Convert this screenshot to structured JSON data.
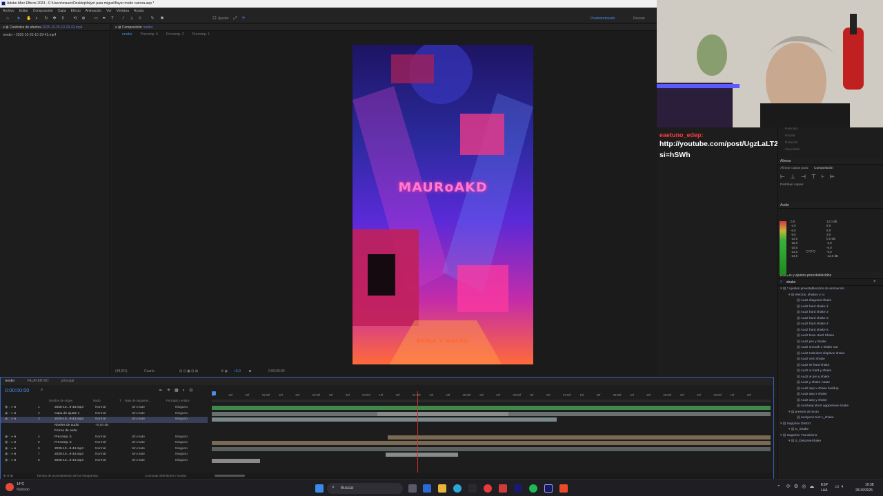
{
  "window": {
    "title": "Adobe After Effects 2024 - C:\\Users\\mauro\\Desktop\\falyer para miguel\\flayer modo carrera.aep *"
  },
  "menu": [
    "Archivo",
    "Editar",
    "Composición",
    "Capa",
    "Efecto",
    "Animación",
    "Ver",
    "Ventana",
    "Ayuda"
  ],
  "toolbar": {
    "snap_label": "Ajustar",
    "workspace_active": "Predeterminado",
    "workspace_other": "Revisar"
  },
  "effects_panel": {
    "title": "Controles de efectos",
    "layer": "2025-10-25-10-29-43.mp4",
    "row": "render • 2025-10-25-10-29-43.mp4"
  },
  "composition_panel": {
    "title": "Composición",
    "comp_name": "render",
    "tabs": [
      "render",
      "Precomp. 5",
      "Precomp. 2",
      "Precomp. 1"
    ],
    "zoom": "(48,5%)",
    "resolution": "Cuarto",
    "exposure": "+0,0",
    "timecode": "0:00:00:00"
  },
  "canvas": {
    "title_text": "MAURoAKD",
    "subtitle_text": "BENJA X NACHO"
  },
  "chat": {
    "username": "eaetuno_edep:",
    "message": "http://youtube.com/post/UgzLaLT28Q8koXw_Xe14AaABCQ?si=hSWh"
  },
  "right_panel": {
    "peek": [
      "Posición",
      "Escala",
      "Rotación",
      "Opacidad"
    ],
    "align_title": "Alinear",
    "align_to_label": "Alinear capas para:",
    "align_to_value": "Composición",
    "distribute_label": "Distribuir capas:",
    "audio_title": "Audio",
    "audio_left_scale": [
      "0,0",
      "-3,0",
      "-6,0",
      "-9,0",
      "-12,0",
      "-15,0",
      "-18,0",
      "-21,0",
      "-24,0"
    ],
    "audio_right_scale": [
      "12,0 dB",
      "9,0",
      "6,0",
      "3,0",
      "0,0 dB",
      "-3,0",
      "-6,0",
      "-9,0",
      "-12,0 dB"
    ],
    "effects_title": "Efectos y ajustes preestablecidos",
    "search_value": "shake",
    "tree": [
      {
        "label": "* Ajustes preestablecidos de animación",
        "depth": 0
      },
      {
        "label": "efectos, shakes y cc",
        "depth": 1
      },
      {
        "label": "Audz diagonal shake",
        "depth": 2
      },
      {
        "label": "Audz hard shake 1",
        "depth": 2
      },
      {
        "label": "Audz hard shake 2",
        "depth": 2
      },
      {
        "label": "Audz hard shake 3",
        "depth": 2
      },
      {
        "label": "Audz hard shake 4",
        "depth": 2
      },
      {
        "label": "Audz hard shake 5",
        "depth": 2
      },
      {
        "label": "Audz New Hard Shake",
        "depth": 2
      },
      {
        "label": "Audz pre y shake",
        "depth": 2
      },
      {
        "label": "Audz smooth x shake out",
        "depth": 2
      },
      {
        "label": "Audz turbulent displace shake",
        "depth": 2
      },
      {
        "label": "Audz velo shake",
        "depth": 2
      },
      {
        "label": "Audz W hard shake",
        "depth": 2
      },
      {
        "label": "Audz w hard y shake",
        "depth": 2
      },
      {
        "label": "Audz w pre y shake",
        "depth": 2
      },
      {
        "label": "Audz y shake rotate",
        "depth": 2
      },
      {
        "label": "Audz aep x shake buildup",
        "depth": 2
      },
      {
        "label": "Audz aep x shake",
        "depth": 2
      },
      {
        "label": "Audz aep y shake",
        "depth": 2
      },
      {
        "label": "Audzaep short aggressive shake",
        "depth": 2
      },
      {
        "label": "presets de texto",
        "depth": 1
      },
      {
        "label": "onelyene text c_shake",
        "depth": 2
      },
      {
        "label": "Sapphire Distort",
        "depth": 0
      },
      {
        "label": "S_Shake",
        "depth": 1
      },
      {
        "label": "Sapphire Transitions",
        "depth": 0
      },
      {
        "label": "S_DissolveShake",
        "depth": 1
      }
    ]
  },
  "timeline": {
    "tabs": [
      "render",
      "FALAYER MC",
      "principal"
    ],
    "timecode": "0:00:00:00",
    "columns": [
      "Nombre de origen",
      "Modo",
      "T",
      "Mate de seguimie...",
      "Principal y enlace"
    ],
    "ruler": [
      "0f",
      "10f",
      "20f",
      "01:00f",
      "10f",
      "20f",
      "02:00f",
      "10f",
      "20f",
      "03:00f",
      "10f",
      "20f",
      "04:00f",
      "10f",
      "20f",
      "05:00f",
      "10f",
      "20f",
      "06:00f",
      "10f",
      "20f",
      "07:00f",
      "10f",
      "20f",
      "08:00f",
      "10f",
      "20f",
      "09:00f",
      "10f",
      "20f",
      "10:00f",
      "10f",
      "20f"
    ],
    "layers": [
      {
        "num": "1",
        "name": "2025-10...9-43.mp4",
        "mode": "Normal",
        "matte": "Sin mate",
        "parent": "Ninguno"
      },
      {
        "num": "2",
        "name": "Capa de ajuste 1",
        "mode": "Normal",
        "matte": "Sin mate",
        "parent": "Ninguno"
      },
      {
        "num": "3",
        "name": "2025-10...9-43.mp4",
        "mode": "Normal",
        "matte": "Sin mate",
        "parent": "Ninguno"
      },
      {
        "num": "",
        "name": "Niveles de audio",
        "mode": "+0,00 dB",
        "matte": "",
        "parent": ""
      },
      {
        "num": "",
        "name": "Forma de onda",
        "mode": "",
        "matte": "",
        "parent": ""
      },
      {
        "num": "4",
        "name": "Precomp. 6",
        "mode": "Normal",
        "matte": "Sin mate",
        "parent": "Ninguno"
      },
      {
        "num": "5",
        "name": "Precomp. 5",
        "mode": "Normal",
        "matte": "Sin mate",
        "parent": "Ninguno"
      },
      {
        "num": "6",
        "name": "2025-10...6-44.mp4",
        "mode": "Normal",
        "matte": "Sin mate",
        "parent": "Ninguno"
      },
      {
        "num": "7",
        "name": "2025-10...6-44.mp4",
        "mode": "Normal",
        "matte": "Sin mate",
        "parent": "Ninguno"
      },
      {
        "num": "8",
        "name": "2025-10...6-44.mp4",
        "mode": "Normal",
        "matte": "Sin mate",
        "parent": "Ninguno"
      }
    ],
    "footer_left": "Tiempo de procesamiento de los fotogramas:",
    "footer_mid": "Conmutar definidores / modos"
  },
  "taskbar": {
    "weather_temp": "14°C",
    "weather_desc": "Nublado",
    "search_placeholder": "Buscar",
    "lang_1": "ESP",
    "lang_2": "LAA",
    "time": "10:38",
    "date": "25/10/2025"
  },
  "colors": {
    "accent_blue": "#4a8de8",
    "bar_green": "#3f8a4a",
    "bar_tan": "#7a6a55",
    "bar_gray": "#6a7070",
    "playhead": "#c83030"
  }
}
